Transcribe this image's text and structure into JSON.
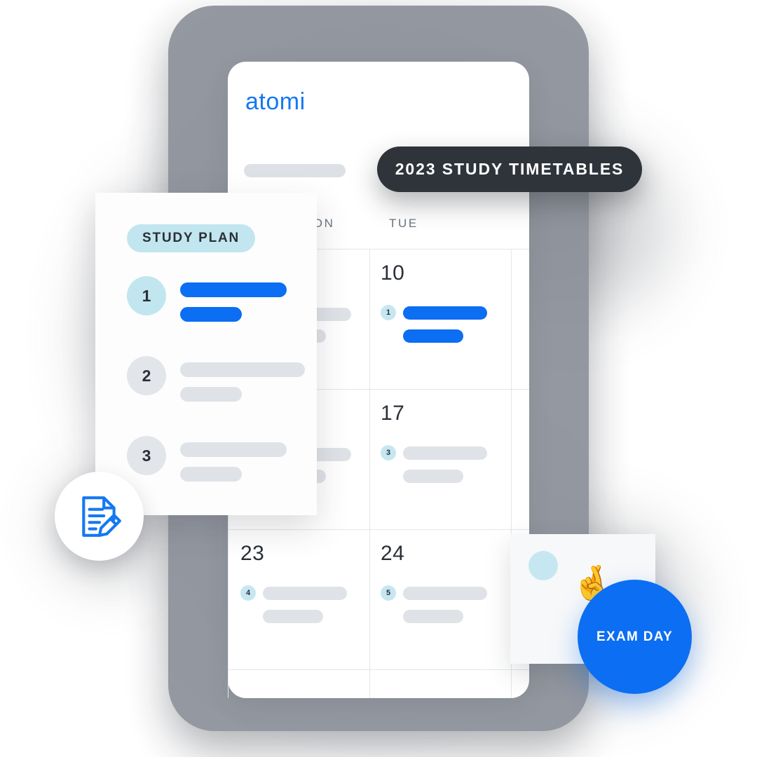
{
  "brand": {
    "logo_text": "atomi",
    "accent_blue": "#0c6ef2",
    "light_blue": "#c6e7f1",
    "dark": "#2f343b",
    "grey_placeholder": "#dfe3e8"
  },
  "banner": {
    "label": "2023 STUDY TIMETABLES"
  },
  "calendar": {
    "weekdays": [
      {
        "label": "MON"
      },
      {
        "label": "TUE"
      }
    ],
    "cells": [
      {
        "day": "10",
        "badge": "1",
        "highlight": "blue"
      },
      {
        "day": "17",
        "badge": "3",
        "highlight": "grey"
      },
      {
        "day": "23",
        "badge": "4",
        "highlight": "grey"
      },
      {
        "day": "24",
        "badge": "5",
        "highlight": "grey"
      }
    ]
  },
  "study_plan": {
    "pill_label": "STUDY PLAN",
    "rows": [
      {
        "number": "1",
        "state": "active"
      },
      {
        "number": "2",
        "state": "inactive"
      },
      {
        "number": "3",
        "state": "inactive"
      }
    ]
  },
  "exam": {
    "label": "EXAM DAY",
    "emoji": "🤞"
  },
  "icons": {
    "document_pencil": "document-pencil-icon"
  }
}
